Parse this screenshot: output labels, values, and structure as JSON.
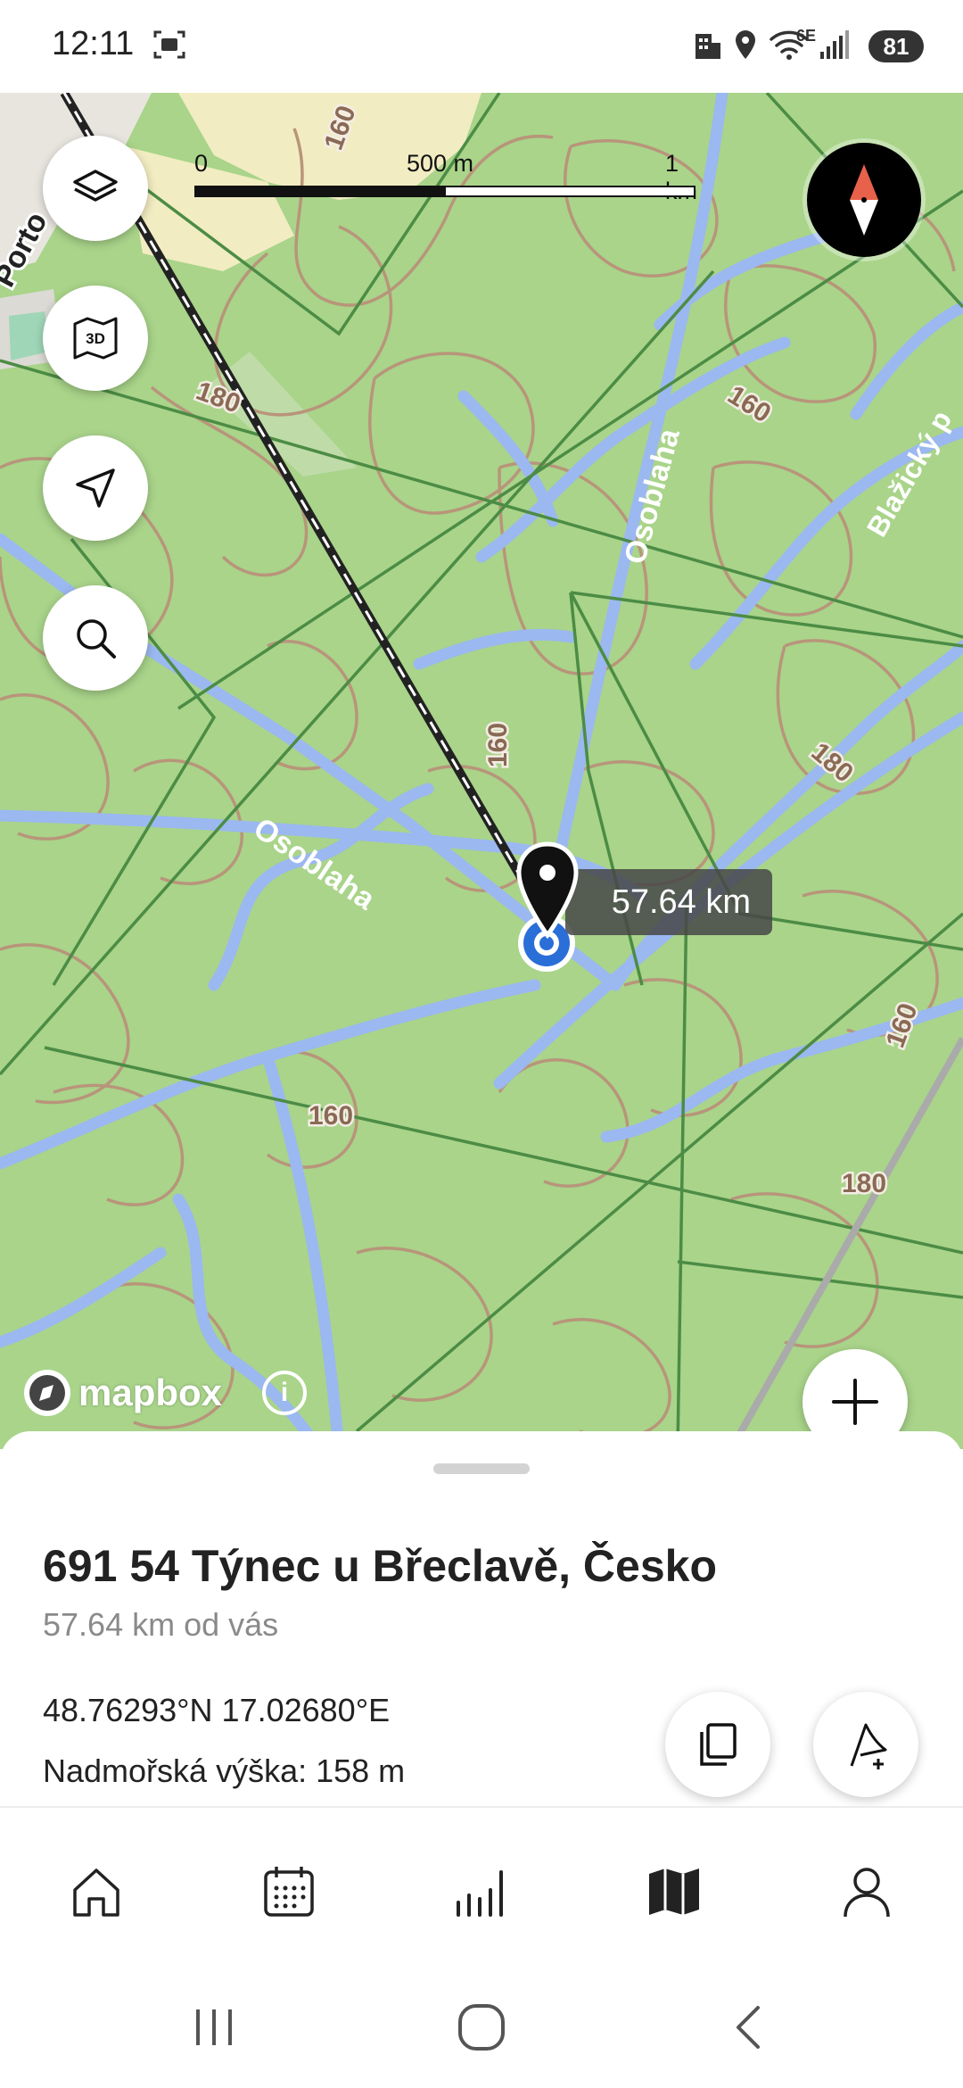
{
  "status_bar": {
    "time": "12:11",
    "battery": "81",
    "network": "6E",
    "icons": [
      "screenshot-icon",
      "business-icon",
      "location-icon",
      "wifi-icon",
      "signal-icon"
    ]
  },
  "map": {
    "scale": {
      "zero": "0",
      "mid": "500 m",
      "max": "1 km"
    },
    "distance_label": "57.64 km",
    "attribution": "mapbox",
    "info_symbol": "i",
    "labels": {
      "porto": "Porto",
      "river_top": "Osoblaha",
      "river_left": "Osoblaha",
      "blazicky": "Blažický p",
      "contour_160_top": "160",
      "contour_180_left": "180",
      "contour_160_right": "160",
      "contour_160_mid": "160",
      "contour_180_right": "180",
      "contour_160_far_right": "160",
      "contour_160_bottom": "160",
      "contour_180_bottom": "180"
    },
    "controls": [
      "layers-button",
      "3d-map-button",
      "navigate-button",
      "search-button",
      "zoom-in-button",
      "compass-button"
    ],
    "colors": {
      "land": "#a9d48a",
      "water": "#9bb8f0",
      "contour": "#b8957a",
      "road": "#4c8c45"
    }
  },
  "sheet": {
    "title": "691 54 Týnec u Břeclavě, Česko",
    "distance": "57.64 km od vás",
    "coordinates": "48.76293°N 17.02680°E",
    "elevation": "Nadmořská výška: 158 m"
  },
  "bottom_nav": {
    "items": [
      {
        "icon": "home-icon"
      },
      {
        "icon": "calendar-icon"
      },
      {
        "icon": "stats-icon"
      },
      {
        "icon": "map-icon",
        "active": true
      },
      {
        "icon": "profile-icon"
      }
    ]
  }
}
